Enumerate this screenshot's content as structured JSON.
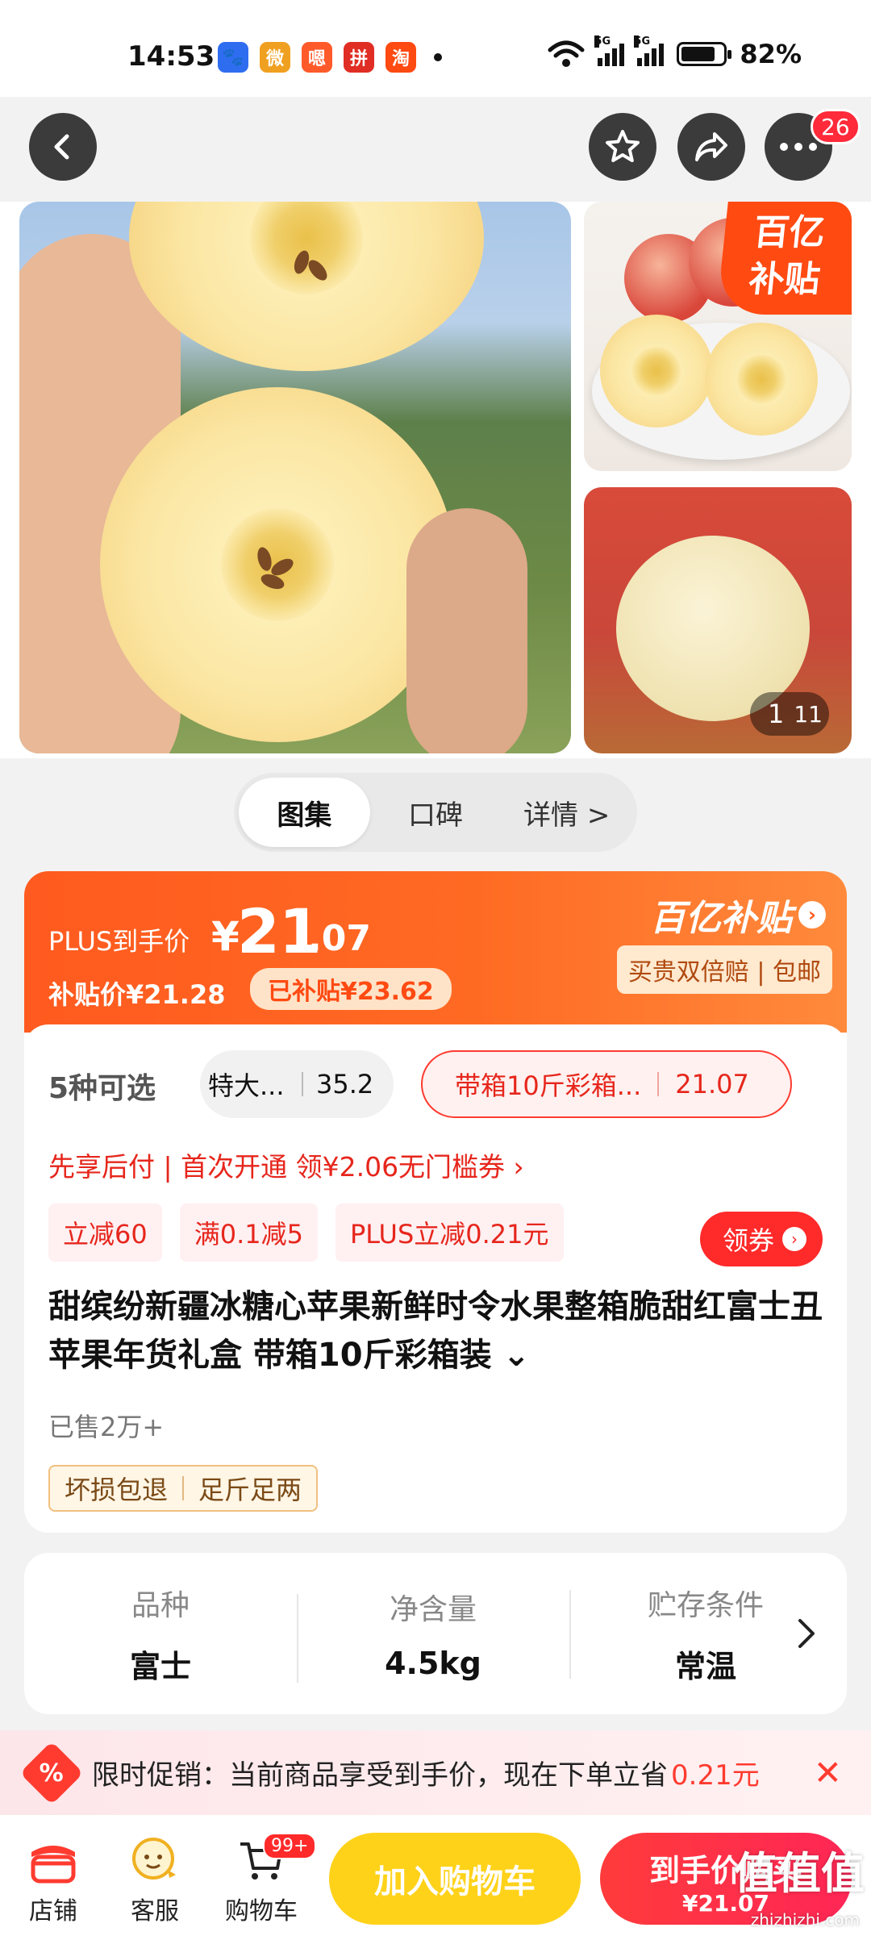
{
  "status_bar": {
    "time": "14:53",
    "battery": "82%",
    "network_tags": [
      "5G",
      "5G"
    ],
    "app_icons": [
      {
        "name": "baidu-icon",
        "glyph": "🐾",
        "color": "#2f6df0"
      },
      {
        "name": "weibo-icon",
        "glyph": "微",
        "color": "#f0a020"
      },
      {
        "name": "news-icon",
        "glyph": "嗯",
        "color": "#ff5a2a"
      },
      {
        "name": "pinduoduo-icon",
        "glyph": "拼",
        "color": "#e02e24"
      },
      {
        "name": "taobao-icon",
        "glyph": "淘",
        "color": "#ff4a12"
      }
    ]
  },
  "header": {
    "notification_count": "26"
  },
  "gallery": {
    "badge": "百亿\n补贴",
    "pager_current": "1",
    "pager_total": "11",
    "tabs": [
      {
        "label": "图集",
        "active": true
      },
      {
        "label": "口碑",
        "active": false
      },
      {
        "label": "详情 >",
        "active": false
      }
    ]
  },
  "price": {
    "plus_label": "PLUS到手价",
    "currency": "¥",
    "integer": "21",
    "decimal": ".07",
    "subsidy_price": "补贴价¥21.28",
    "subsidized": "已补贴¥23.62",
    "program_logo": "百亿补贴",
    "guarantee": "买贵双倍赔 | 包邮"
  },
  "options": {
    "count_label": "5种可选",
    "option1_label": "特大...",
    "option1_price": "35.2",
    "option2_label": "带箱10斤彩箱...",
    "option2_price": "21.07"
  },
  "pay_later": "先享后付 | 首次开通 领¥2.06无门槛券 ›",
  "coupons": [
    "立减60",
    "满0.1减5",
    "PLUS立减0.21元"
  ],
  "get_coupon_label": "领券",
  "product": {
    "title": "甜缤纷新疆冰糖心苹果新鲜时令水果整箱脆甜红富士丑苹果年货礼盒 带箱10斤彩箱装 ⌄",
    "sold": "已售2万+",
    "services": [
      "坏损包退",
      "足斤足两"
    ]
  },
  "specs": [
    {
      "key": "品种",
      "value": "富士"
    },
    {
      "key": "净含量",
      "value": "4.5kg"
    },
    {
      "key": "贮存条件",
      "value": "常温"
    }
  ],
  "promo": {
    "icon": "%",
    "text": "限时促销：当前商品享受到手价，现在下单立省",
    "amount": "0.21元"
  },
  "bottom_nav": [
    {
      "label": "店铺"
    },
    {
      "label": "客服"
    },
    {
      "label": "购物车",
      "badge": "99+"
    }
  ],
  "actions": {
    "add_to_cart": "加入购物车",
    "buy_line1": "到手价购买",
    "buy_line2": "¥21.07"
  },
  "watermark": {
    "logo": "值值值",
    "site": "zhizhizhi.com"
  }
}
